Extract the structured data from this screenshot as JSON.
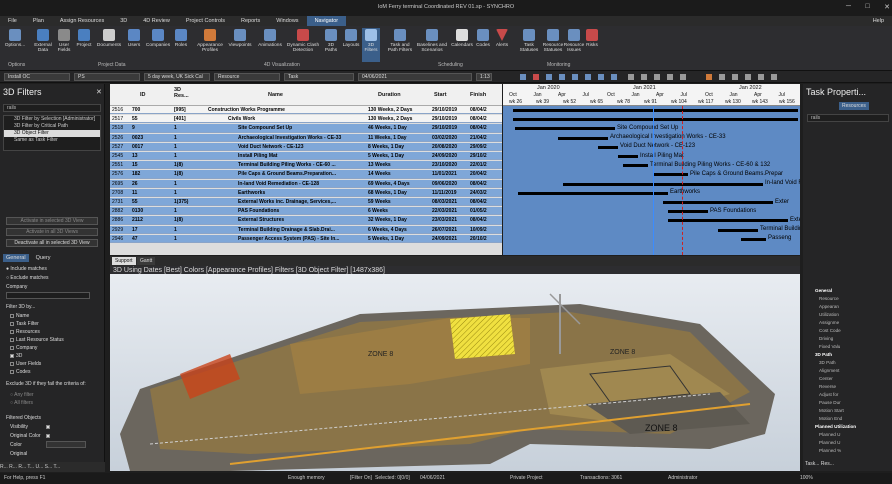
{
  "title": "IoM Ferry terminal Coordinated REV 01.sp - SYNCHRO",
  "help": "Help",
  "menu": [
    "File",
    "Plan",
    "Assign Resources",
    "3D",
    "4D Review",
    "Project Controls",
    "Reports",
    "Windows",
    "Navigator"
  ],
  "ribbon": {
    "buttons": [
      "Options...",
      "External Data",
      "User Fields",
      "Project",
      "Documents",
      "Users",
      "Companies",
      "Roles",
      "Appearance Profiles",
      "Viewpoints",
      "Animations",
      "Dynamic Clash Detection",
      "3D Paths",
      "Layouts",
      "3D Filters",
      "Task and Path Filters",
      "Baselines and Scenarios",
      "Calendars",
      "Codes",
      "Alerts",
      "Task Statuses",
      "Resource Statuses",
      "Resource Issues",
      "Risks"
    ],
    "groups": [
      "Options",
      "Project Data",
      "4D Visualization",
      "Scheduling",
      "Monitoring"
    ]
  },
  "toolbar": {
    "filter": "Install OC",
    "ps": "PS",
    "calendar": "5 day week, UK Sick Cal",
    "resource": "Resource",
    "task": "Task",
    "date": "04/06/2021",
    "zoom": "1:13"
  },
  "left": {
    "title": "3D Filters",
    "search": "rails",
    "filters": [
      "3D Filter by Selection [Administrator]",
      "3D Filter by Critical Path",
      "3D Object Filter",
      "Same as Task Filter"
    ],
    "btn1": "Activate in selected 3D View",
    "btn2": "Activate in all 3D Views",
    "btn3": "Deactivate all in selected 3D View",
    "tabs": [
      "General",
      "Query"
    ],
    "include": "Include matches",
    "exclude": "Exclude matches",
    "company": "Company",
    "filterby": "Filter 3D by...",
    "opts": [
      "Name",
      "Task Filter",
      "Resources",
      "Last Resource Status",
      "Company",
      "3D",
      "User Fields",
      "Codes"
    ],
    "exclude_title": "Exclude 3D if they fail the criteria of:",
    "any": "Any filter",
    "all": "All filters",
    "filtered": "Filtered Objects",
    "visibility": "Visibility",
    "origcolor": "Original Color",
    "color": "Color",
    "original": "Original"
  },
  "table": {
    "cols": [
      "ID",
      "3D Res...",
      "Name",
      "Duration",
      "Start",
      "Finish"
    ],
    "rows": [
      [
        "2516",
        "700",
        "[995]",
        "Construction Works Programme",
        "130 Weeks, 2 Days",
        "29/10/2019",
        "08/04/2"
      ],
      [
        "2517",
        "55",
        "[401]",
        "Civils Work",
        "130 Weeks, 2 Days",
        "29/10/2019",
        "08/04/2"
      ],
      [
        "2518",
        "9",
        "1",
        "Site Compound Set Up",
        "46 Weeks, 1 Day",
        "29/10/2019",
        "08/04/2"
      ],
      [
        "2526",
        "0023",
        "1",
        "Archaeological Investigation Works - CE-33",
        "11 Weeks, 1 Day",
        "03/02/2020",
        "21/04/2"
      ],
      [
        "2527",
        "0017",
        "1",
        "Void Duct Network - CE-123",
        "8 Weeks, 1 Day",
        "20/08/2020",
        "29/09/2"
      ],
      [
        "2545",
        "13",
        "1",
        "Install Piling Mat",
        "5 Weeks, 1 Day",
        "24/09/2020",
        "29/10/2"
      ],
      [
        "2551",
        "15",
        "1(8)",
        "Terminal Building Piling Works - CE-60 ...",
        "13 Weeks",
        "23/10/2020",
        "22/01/2"
      ],
      [
        "2576",
        "182",
        "1(8)",
        "Pile Caps & Ground Beams.Preparation...",
        "14 Weeks",
        "11/01/2021",
        "20/04/2"
      ],
      [
        "2695",
        "26",
        "1",
        "In-land Void Remediation - CE-128",
        "69 Weeks, 4 Days",
        "09/06/2020",
        "08/04/2"
      ],
      [
        "2708",
        "11",
        "1",
        "Earthworks",
        "68 Weeks, 1 Day",
        "11/11/2019",
        "24/03/2"
      ],
      [
        "2731",
        "55",
        "1(375)",
        "External Works inc. Drainage, Services,...",
        "59 Weeks",
        "08/03/2021",
        "08/04/2"
      ],
      [
        "2882",
        "0130",
        "1",
        "PAS Foundations",
        "6 Weeks",
        "22/03/2021",
        "01/05/2"
      ],
      [
        "2886",
        "2112",
        "1(8)",
        "External Structures",
        "32 Weeks, 1 Day",
        "23/03/2021",
        "08/04/2"
      ],
      [
        "2929",
        "17",
        "1",
        "Terminal Building Drainage & Slab.Drai...",
        "6 Weeks, 4 Days",
        "26/07/2021",
        "10/09/2"
      ],
      [
        "2946",
        "47",
        "1",
        "Passenger Access System (PAS) - Site In...",
        "5 Weeks, 1 Day",
        "24/09/2021",
        "20/10/2"
      ]
    ]
  },
  "gantt": {
    "years": [
      "Jan 2020",
      "Jan 2021",
      "Jan 2022"
    ],
    "months": [
      "Oct",
      "Jan",
      "Apr",
      "Jul",
      "Oct",
      "Jan",
      "Apr",
      "Jul",
      "Oct",
      "Jan",
      "Apr",
      "Jul"
    ],
    "weeks": [
      "wk 26",
      "wk 39",
      "wk 52",
      "wk 65",
      "wk 78",
      "wk 91",
      "wk 104",
      "wk 117",
      "wk 130",
      "wk 143",
      "wk 156"
    ],
    "labels": [
      "Site Compound Set Up",
      "Archaeological Investigation Works - CE-33",
      "Void Duct Network - CE-123",
      "Install Piling Mat",
      "Terminal Building Piling Works - CE-60 & 132",
      "Pile Caps & Ground Beams.Prepar",
      "In-land Void Remediation - C",
      "Earthworks",
      "Exter",
      "PAS Foundations",
      "External S",
      "Terminal Building Dr",
      "Passeng"
    ]
  },
  "tabs": [
    "Support",
    "Gantt"
  ],
  "view3d": {
    "header": "3D Using Dates [Best] Colors [Appearance Profiles] Filters [3D Object Filter]  [1487x386]",
    "zones": [
      "ZONE 8",
      "ZONE 8",
      "ZONE 8"
    ]
  },
  "right": {
    "title": "Task Properti...",
    "tab": "Resources",
    "search": "rails",
    "items": [
      [
        "General",
        true
      ],
      [
        "Resource",
        false
      ],
      [
        "Appearan",
        false
      ],
      [
        "Utilization",
        false
      ],
      [
        "Assignme",
        false
      ],
      [
        "Cost Code",
        false
      ],
      [
        "Driving",
        false
      ],
      [
        "Fixed Valu",
        false
      ],
      [
        "3D Path",
        true
      ],
      [
        "3D Path",
        false
      ],
      [
        "Alignment",
        false
      ],
      [
        "Center",
        false
      ],
      [
        "Reverse",
        false
      ],
      [
        "Adjust for",
        false
      ],
      [
        "Pause Dur",
        false
      ],
      [
        "Motion Start",
        false
      ],
      [
        "Motion End",
        false
      ],
      [
        "Planned Utilization",
        true
      ],
      [
        "Planned U",
        false
      ],
      [
        "Planned U",
        false
      ],
      [
        "Planned %",
        false
      ]
    ],
    "bottom": "Task... Res..."
  },
  "bottomtabs": "R... R... R... T... U... S... T...",
  "status": {
    "help": "For Help, press F1",
    "memory": "Enough memory",
    "filter": "[Filter On]",
    "selected": "Selected: 0[0/0]",
    "date": "04/06/2021",
    "project": "Private Project",
    "transactions": "Transactions: 3061",
    "user": "Administrator",
    "zoom": "100%"
  }
}
